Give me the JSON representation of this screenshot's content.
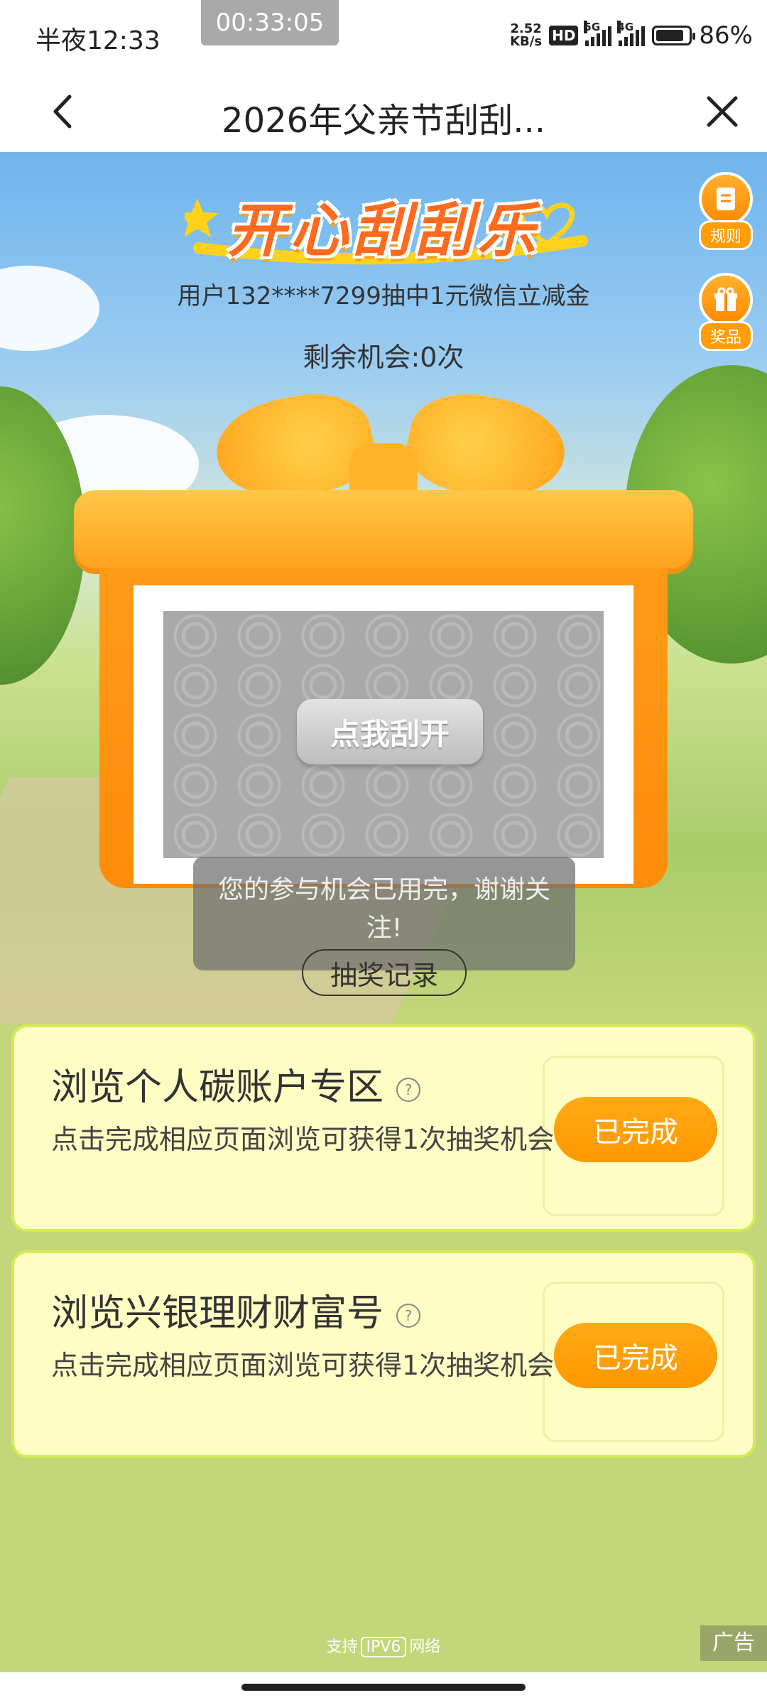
{
  "status_bar": {
    "time": "半夜12:33",
    "timer": "00:33:05",
    "net_speed": "2.52",
    "net_speed_unit": "KB/s",
    "hd_badge": "HD",
    "sim1": "5G",
    "sim2": "4G",
    "battery_level": 0.86,
    "battery_text": "86%"
  },
  "header": {
    "title": "2026年父亲节刮刮...",
    "back_icon": "chevron-left-icon",
    "close_icon": "close-icon"
  },
  "hero": {
    "logo_text": "开心刮刮乐",
    "winner_text": "用户132****7299抽中1元微信立减金",
    "remaining_text": "剩余机会:0次",
    "side_buttons": [
      {
        "label": "规则",
        "icon": "document-icon"
      },
      {
        "label": "奖品",
        "icon": "gift-icon"
      }
    ],
    "scratch_button": "点我刮开",
    "toast": "您的参与机会已用完，谢谢关注!",
    "record_button": "抽奖记录"
  },
  "tasks": [
    {
      "title": "浏览个人碳账户专区",
      "help_icon": "question-icon",
      "description": "点击完成相应页面浏览可获得1次抽奖机会",
      "button": "已完成"
    },
    {
      "title": "浏览兴银理财财富号",
      "help_icon": "question-icon",
      "description": "点击完成相应页面浏览可获得1次抽奖机会",
      "button": "已完成"
    }
  ],
  "footer": {
    "support_prefix": "支持",
    "ipv6": "IPV6",
    "support_suffix": "网络",
    "ad_label": "广告"
  },
  "colors": {
    "accent_orange": "#ff9800",
    "card_bg": "#fdfdc4",
    "card_border": "#d6ec54",
    "page_bg": "#c4d67a"
  }
}
